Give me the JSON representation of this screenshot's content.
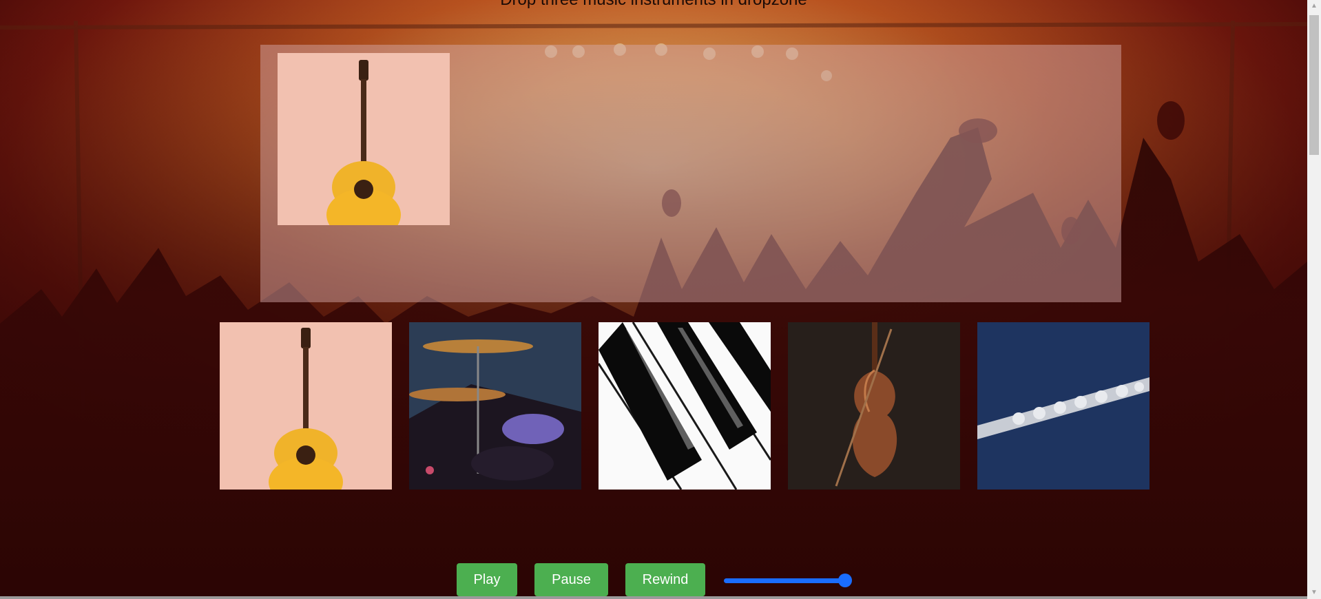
{
  "page": {
    "heading": "Drop three music instruments in dropzone"
  },
  "dropzone": {
    "items": [
      {
        "name": "guitar"
      }
    ]
  },
  "instruments": [
    {
      "name": "guitar"
    },
    {
      "name": "drums"
    },
    {
      "name": "piano"
    },
    {
      "name": "violin"
    },
    {
      "name": "flute"
    }
  ],
  "controls": {
    "play_label": "Play",
    "pause_label": "Pause",
    "rewind_label": "Rewind",
    "volume_level": 1.0
  },
  "colors": {
    "button_green": "#4caf50",
    "slider_blue": "#1a6dff"
  }
}
